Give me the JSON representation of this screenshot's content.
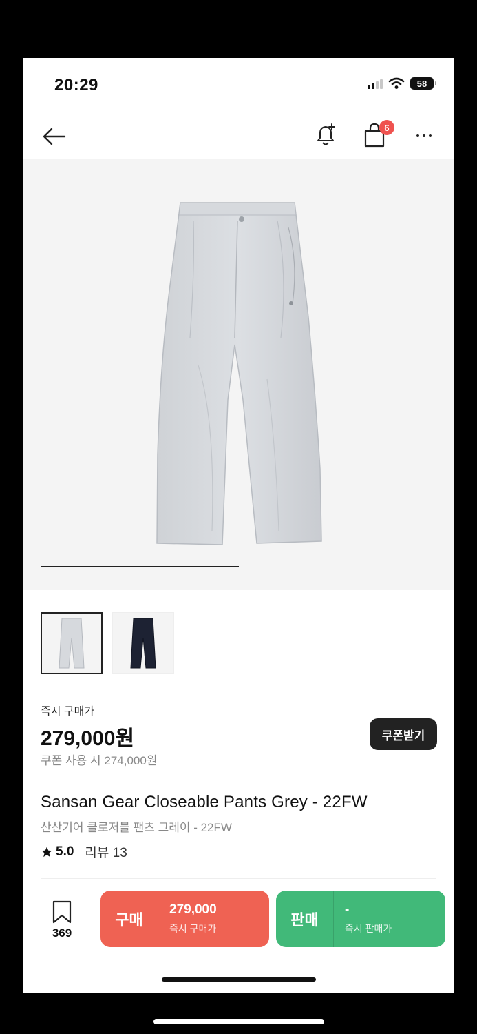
{
  "status": {
    "time": "20:29",
    "battery": "58"
  },
  "header": {
    "cart_count": "6"
  },
  "gallery": {
    "progress": 0.5
  },
  "price": {
    "label": "즉시 구매가",
    "value": "279,000원",
    "coupon_text": "쿠폰 사용 시 274,000원",
    "coupon_button": "쿠폰받기"
  },
  "product": {
    "title_en": "Sansan Gear Closeable Pants Grey - 22FW",
    "title_ko": "산산기어 클로저블 팬츠 그레이 - 22FW",
    "rating": "5.0",
    "reviews": "리뷰 13"
  },
  "bottom_bar": {
    "bookmark_count": "369",
    "buy": {
      "label": "구매",
      "price": "279,000",
      "sub": "즉시 구매가"
    },
    "sell": {
      "label": "판매",
      "price": "-",
      "sub": "즉시 판매가"
    }
  },
  "colors": {
    "buy": "#ef6253",
    "sell": "#41b979",
    "badge": "#ef5350"
  },
  "icons": [
    "back-arrow-icon",
    "bell-plus-icon",
    "shopping-bag-icon",
    "more-icon",
    "bookmark-icon",
    "star-icon"
  ]
}
